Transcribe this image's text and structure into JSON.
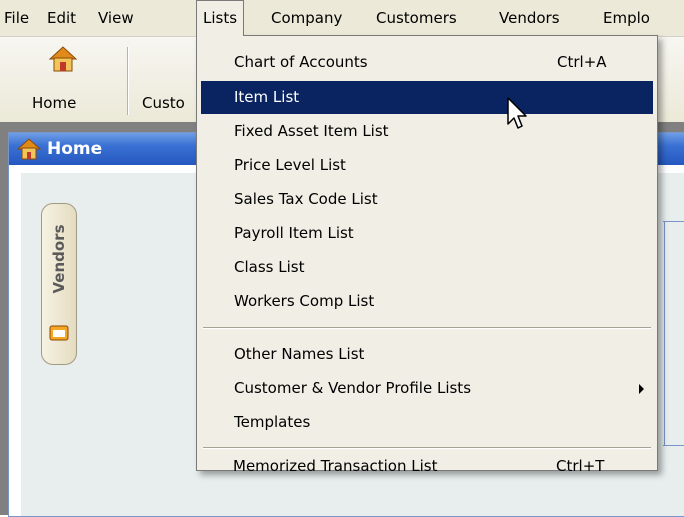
{
  "menubar": {
    "items": [
      {
        "label": "File"
      },
      {
        "label": "Edit"
      },
      {
        "label": "View"
      },
      {
        "label": "Lists"
      },
      {
        "label": "Company"
      },
      {
        "label": "Customers"
      },
      {
        "label": "Vendors"
      },
      {
        "label": "Emplo"
      }
    ]
  },
  "toolbar": {
    "home_label": "Home",
    "customers_label": "Custo"
  },
  "window": {
    "title": "Home",
    "vendors_tab": "Vendors"
  },
  "lists_menu": {
    "items": [
      {
        "label": "Chart of Accounts",
        "shortcut": "Ctrl+A"
      },
      {
        "label": "Item List",
        "shortcut": "",
        "highlighted": true
      },
      {
        "label": "Fixed Asset Item List",
        "shortcut": ""
      },
      {
        "label": "Price Level List",
        "shortcut": ""
      },
      {
        "label": "Sales Tax Code List",
        "shortcut": ""
      },
      {
        "label": "Payroll Item List",
        "shortcut": ""
      },
      {
        "label": "Class List",
        "shortcut": ""
      },
      {
        "label": "Workers Comp List",
        "shortcut": ""
      },
      {
        "label": "Other Names List",
        "shortcut": ""
      },
      {
        "label": "Customer & Vendor Profile Lists",
        "shortcut": "",
        "submenu": true
      },
      {
        "label": "Templates",
        "shortcut": ""
      },
      {
        "label": "Memorized Transaction List",
        "shortcut": "Ctrl+T"
      }
    ]
  },
  "colors": {
    "highlight": "#0a2461",
    "title_bar": "#2558c0",
    "menu_bg": "#f0eee5"
  }
}
